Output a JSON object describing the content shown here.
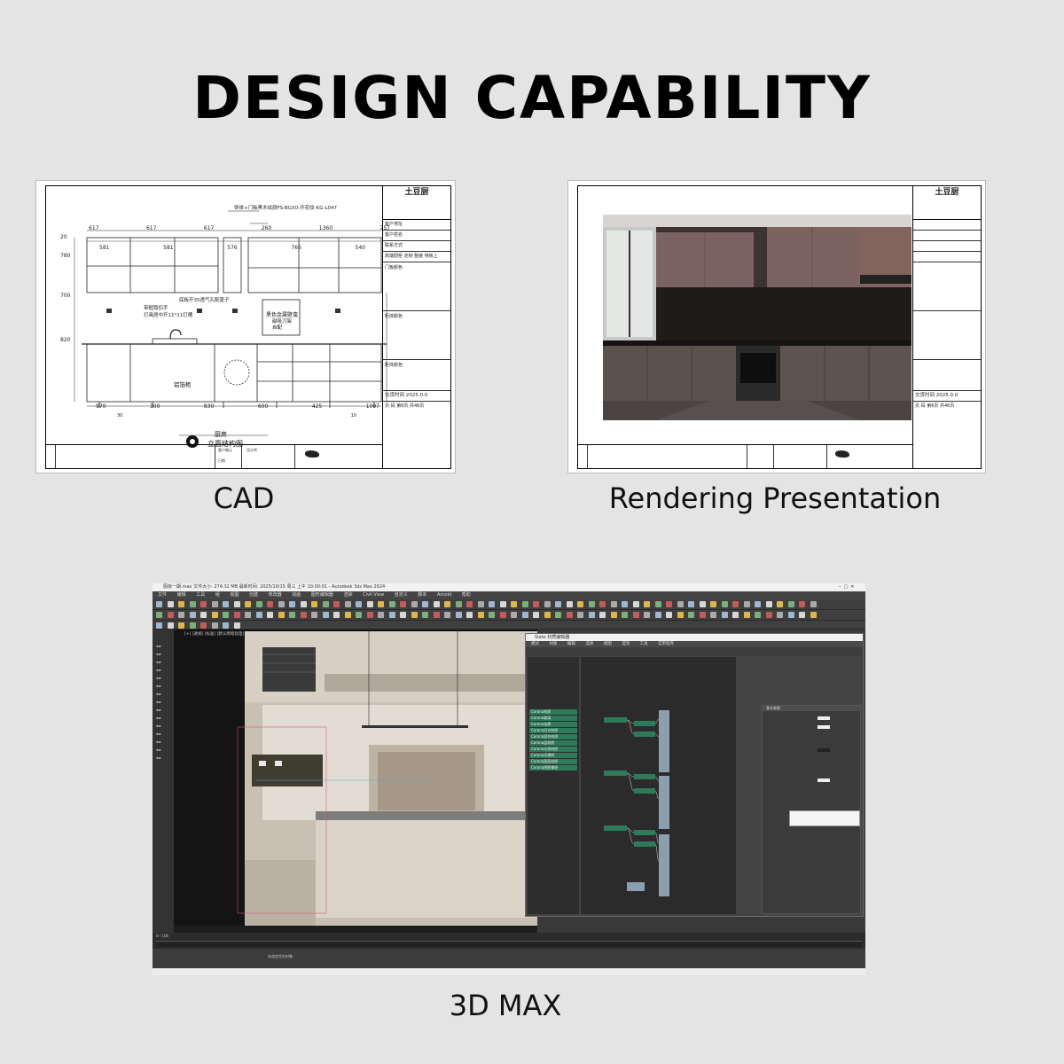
{
  "heading": "DESIGN CAPABILITY",
  "panels": {
    "cad": {
      "caption": "CAD",
      "drawing_title": "立面结构图",
      "drawing_subtitle": "厨房",
      "labels": {
        "cabinet": "铝箔柜",
        "dark_panel": "黑色金属壁龛",
        "magnet": "磁吸刀架\n自配",
        "note_top": "饰体+门板黑木纹颜FS-BGX0-开花纹-KG-L047",
        "note_handle": "带框隐扣手\n灯具居中开11*11灯槽",
        "note_seal": "底板开35透气孔配盖子"
      },
      "dims_top": [
        "617",
        "617",
        "617",
        "260",
        "1360",
        "257",
        "581",
        "581",
        "576",
        "766",
        "540"
      ],
      "dims_left": [
        "20",
        "780",
        "700",
        "820"
      ],
      "dims_bottom": [
        "970",
        "300",
        "830",
        "600",
        "425",
        "1007",
        "30",
        "10"
      ],
      "title_block": {
        "brand": "土豆厨",
        "rows": [
          "客户地址",
          "客户姓名",
          "联系方式",
          "高端厨柜 定制 整装",
          "门板颜色",
          "柜体颜色",
          "柜体颜色"
        ],
        "material": "特板上",
        "date_label": "交货时间",
        "date": "2025.0.0",
        "page_label": "页 码",
        "page": "第6页 共46页"
      },
      "notes_labels": [
        "客户确认",
        "设计师",
        "日期"
      ]
    },
    "rendering": {
      "caption": "Rendering Presentation",
      "title_block": {
        "brand": "土豆厨",
        "date_label": "交货时间",
        "date": "2025.0.0",
        "page_label": "页 码",
        "page": "第6页 共46页"
      }
    },
    "max": {
      "caption": "3D MAX",
      "window_title": "厨房一期.max  文件大小: 274.32 MB  最新时间: 2025/10/15 周三 上午 10:00:01 - Autodesk 3ds Max 2024",
      "menu": [
        "文件",
        "编辑",
        "工具",
        "组",
        "视图",
        "创建",
        "修改器",
        "动画",
        "图形编辑器",
        "渲染",
        "Civil View",
        "自定义",
        "脚本",
        "Arnold",
        "帮助"
      ],
      "viewport_label": "[+] [透视] [标准] [默认明暗处理]",
      "slate_title": "Slate 材质编辑器",
      "slate_menu": [
        "模式",
        "材质",
        "编辑",
        "选择",
        "视图",
        "选项",
        "工具",
        "实用程序"
      ],
      "browser_items": [
        "Corona材质",
        "Corona玻璃",
        "Corona金属",
        "Corona灯光材质",
        "Corona混合材质",
        "Corona层材质",
        "Corona光线材质",
        "Corona半透明",
        "Corona双面材质",
        "Corona阴影捕捉"
      ],
      "params_title": "基本参数",
      "frame_range": "0 / 100",
      "status": "未选定任何对象"
    }
  },
  "colors": {
    "background": "#e4e4e4",
    "cabinet_upper": "#7d6360",
    "cabinet_lower": "#5a524d",
    "node_green": "#2f7a5a",
    "ui_dark": "#3a3a3a"
  }
}
